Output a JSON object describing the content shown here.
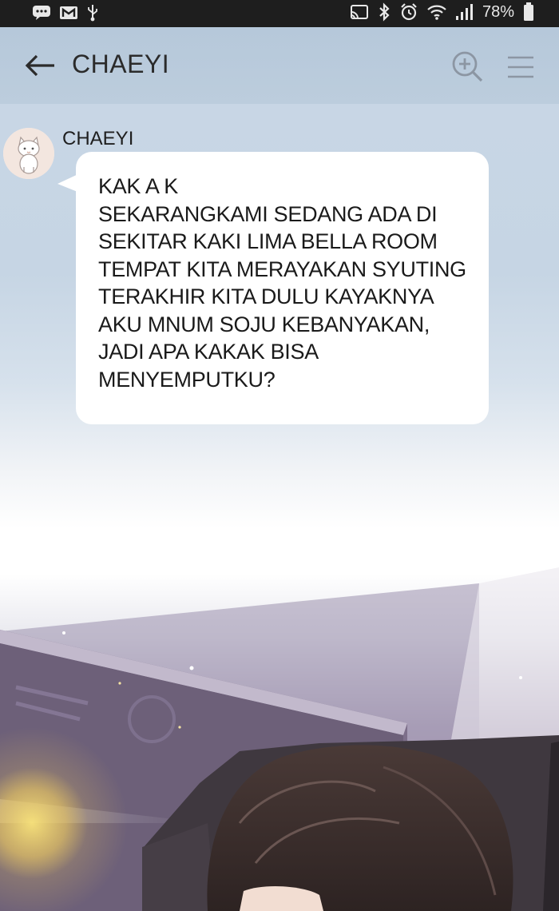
{
  "status_bar": {
    "battery_percent": "78%",
    "icons": [
      "chat-icon",
      "gmail-icon",
      "usb-icon",
      "cast-icon",
      "bluetooth-icon",
      "alarm-icon",
      "wifi-icon",
      "signal-icon",
      "battery-icon"
    ]
  },
  "header": {
    "title": "CHAEYI",
    "icons": [
      "back-arrow-icon",
      "zoom-in-icon",
      "menu-icon"
    ]
  },
  "message": {
    "sender": "CHAEYI",
    "lines": [
      "KAK A K",
      "SEKARANGKAMI SEDANG ADA DI",
      "SEKITAR KAKI LIMA BELLA ROOM",
      "TEMPAT KITA MERAYAKAN SYUTING",
      "TERAKHIR KITA DULU KAYAKNYA",
      "AKU MNUM SOJU KEBANYAKAN,",
      "JADI APA KAKAK BISA",
      "MENYEMPUTKU?"
    ]
  },
  "colors": {
    "header_bg": "#b6c8da",
    "bubble_bg": "#ffffff",
    "status_bar_bg": "#1e1e1e"
  }
}
